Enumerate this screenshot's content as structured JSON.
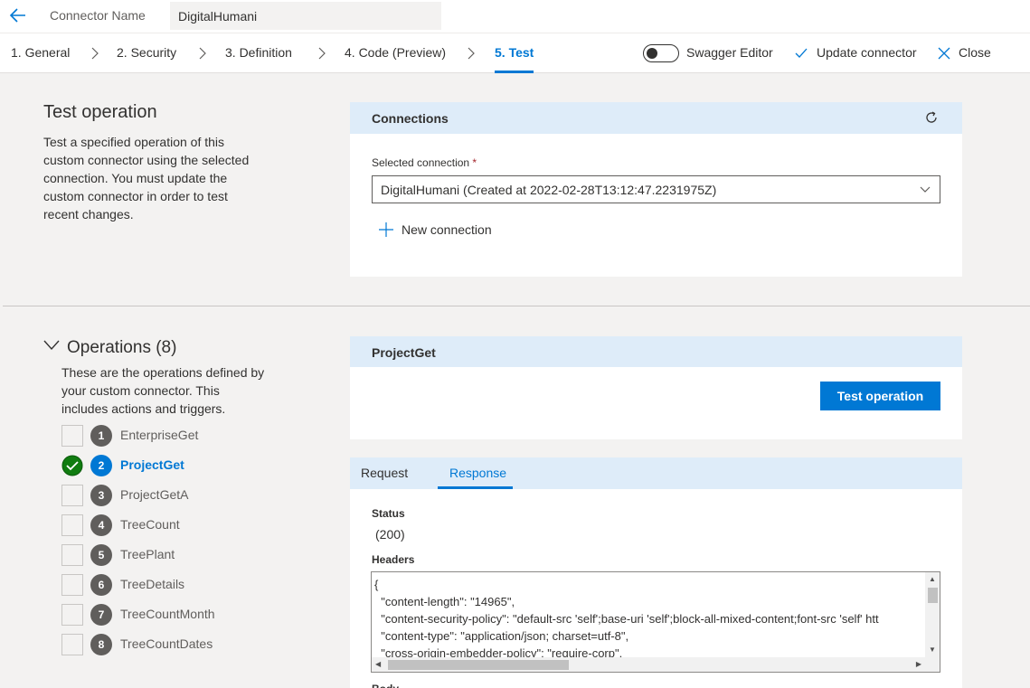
{
  "header": {
    "connector_name_label": "Connector Name",
    "connector_name_value": "DigitalHumani"
  },
  "nav": {
    "steps": [
      "1. General",
      "2. Security",
      "3. Definition",
      "4. Code (Preview)",
      "5. Test"
    ],
    "active_step": 4,
    "swagger_editor_label": "Swagger Editor",
    "swagger_editor_on": false,
    "update_connector_label": "Update connector",
    "close_label": "Close"
  },
  "test_operation": {
    "title": "Test operation",
    "description": "Test a specified operation of this custom connector using the selected connection. You must update the custom connector in order to test recent changes."
  },
  "connections": {
    "title": "Connections",
    "selected_connection_label": "Selected connection",
    "required_marker": "*",
    "selected_value": "DigitalHumani (Created at 2022-02-28T13:12:47.2231975Z)",
    "new_connection_label": "New connection"
  },
  "operations": {
    "title": "Operations (8)",
    "description": "These are the operations defined by your custom connector. This includes actions and triggers.",
    "items": [
      {
        "num": "1",
        "label": "EnterpriseGet",
        "done": false,
        "active": false
      },
      {
        "num": "2",
        "label": "ProjectGet",
        "done": true,
        "active": true
      },
      {
        "num": "3",
        "label": "ProjectGetA",
        "done": false,
        "active": false
      },
      {
        "num": "4",
        "label": "TreeCount",
        "done": false,
        "active": false
      },
      {
        "num": "5",
        "label": "TreePlant",
        "done": false,
        "active": false
      },
      {
        "num": "6",
        "label": "TreeDetails",
        "done": false,
        "active": false
      },
      {
        "num": "7",
        "label": "TreeCountMonth",
        "done": false,
        "active": false
      },
      {
        "num": "8",
        "label": "TreeCountDates",
        "done": false,
        "active": false
      }
    ]
  },
  "operation_panel": {
    "title": "ProjectGet",
    "test_button_label": "Test operation"
  },
  "response_panel": {
    "tabs": [
      "Request",
      "Response"
    ],
    "active_tab": 1,
    "status_label": "Status",
    "status_value": "(200)",
    "headers_label": "Headers",
    "headers_lines": [
      "{",
      "  \"content-length\": \"14965\",",
      "  \"content-security-policy\": \"default-src 'self';base-uri 'self';block-all-mixed-content;font-src 'self' htt",
      "  \"content-type\": \"application/json; charset=utf-8\",",
      "  \"cross-origin-embedder-policy\": \"require-corp\","
    ],
    "body_label": "Body"
  },
  "colors": {
    "accent": "#0078d4",
    "card_header": "#deecf9",
    "success": "#107c10"
  }
}
